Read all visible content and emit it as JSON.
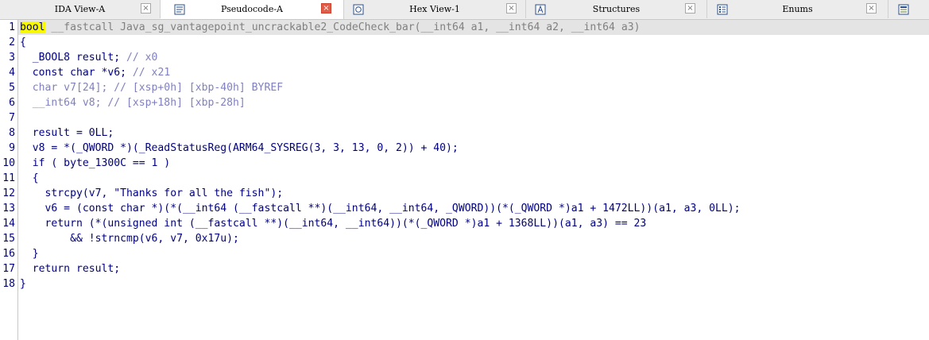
{
  "tabs": [
    {
      "label": "IDA View-A",
      "active": false,
      "close_style": "grey"
    },
    {
      "label": "Pseudocode-A",
      "active": true,
      "close_style": "red"
    },
    {
      "label": "Hex View-1",
      "active": false,
      "close_style": "grey"
    },
    {
      "label": "Structures",
      "active": false,
      "close_style": "grey"
    },
    {
      "label": "Enums",
      "active": false,
      "close_style": "grey"
    }
  ],
  "close_glyph": "×",
  "line_numbers": [
    "1",
    "2",
    "3",
    "4",
    "5",
    "6",
    "7",
    "8",
    "9",
    "10",
    "11",
    "12",
    "13",
    "14",
    "15",
    "16",
    "17",
    "18"
  ],
  "code": {
    "l1": {
      "kw": "bool",
      "rest_grey": " __fastcall ",
      "fname": "Java_sg_vantagepoint_uncrackable2_CodeCheck_bar",
      "args": "(__int64 a1, __int64 a2, __int64 a3)"
    },
    "l2": "{",
    "l3": {
      "code": "  _BOOL8 result; ",
      "comment": "// x0"
    },
    "l4": {
      "code": "  const char *v6; ",
      "comment": "// x21"
    },
    "l5": {
      "code": "  char v7[24]; // [xsp+0h] [xbp-40h] BYREF"
    },
    "l6": {
      "code": "  __int64 v8; // [xsp+18h] [xbp-28h]"
    },
    "l8": "  result = 0LL;",
    "l9": "  v8 = *(_QWORD *)(_ReadStatusReg(ARM64_SYSREG(3, 3, 13, 0, 2)) + 40);",
    "l10": "  if ( byte_1300C == 1 )",
    "l11": "  {",
    "l12": "    strcpy(v7, \"Thanks for all the fish\");",
    "l13": "    v6 = (const char *)(*(__int64 (__fastcall **)(__int64, __int64, _QWORD))(*(_QWORD *)a1 + 1472LL))(a1, a3, 0LL);",
    "l14": "    return (*(unsigned int (__fastcall **)(__int64, __int64))(*(_QWORD *)a1 + 1368LL))(a1, a3) == 23",
    "l15": "        && !strncmp(v6, v7, 0x17u);",
    "l16": "  }",
    "l17": "  return result;",
    "l18": "}"
  },
  "colors": {
    "highlight": "#f8f800",
    "line_highlight": "#e4e4e4",
    "code": "#000080",
    "comment": "#8080c0"
  }
}
